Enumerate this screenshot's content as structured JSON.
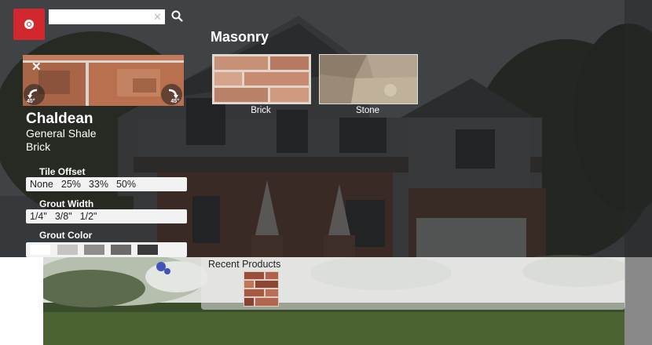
{
  "search": {
    "value": "",
    "placeholder": ""
  },
  "swatch": {
    "rotate_left_label": "45°",
    "rotate_right_label": "45°"
  },
  "product": {
    "name": "Chaldean",
    "line": "General Shale",
    "type": "Brick"
  },
  "tile_offset": {
    "label": "Tile Offset",
    "options": [
      "None",
      "25%",
      "33%",
      "50%"
    ]
  },
  "grout_width": {
    "label": "Grout Width",
    "options": [
      "1/4\"",
      "3/8\"",
      "1/2\""
    ]
  },
  "grout_color": {
    "label": "Grout Color",
    "colors": [
      "#ffffff",
      "#c4c4c4",
      "#8e8e8e",
      "#6a6a6a",
      "#3a3a3a"
    ]
  },
  "masonry": {
    "title": "Masonry",
    "categories": [
      {
        "label": "Brick"
      },
      {
        "label": "Stone"
      }
    ]
  },
  "recent": {
    "title": "Recent Products"
  },
  "colors": {
    "accent": "#d3272e"
  }
}
